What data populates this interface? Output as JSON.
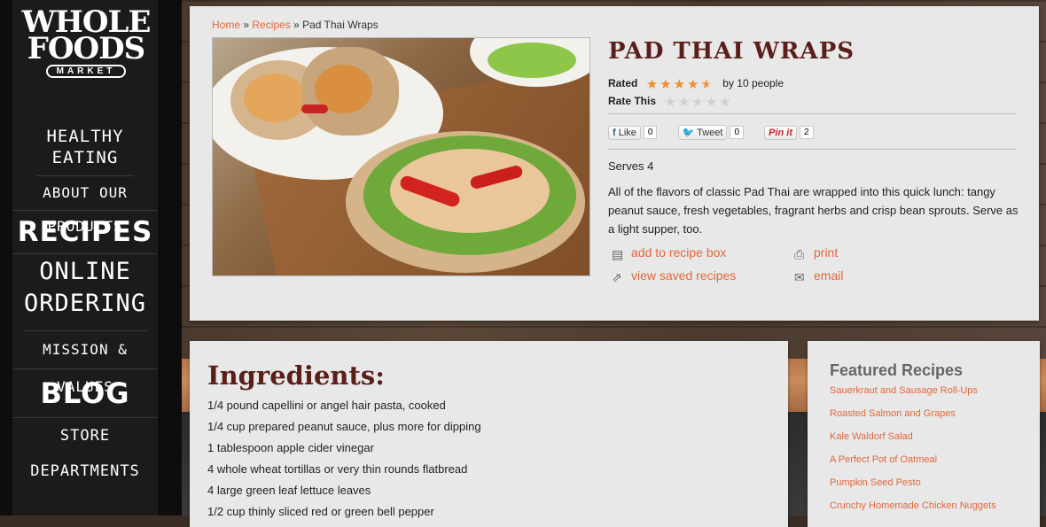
{
  "brand": {
    "line1": "WHOLE",
    "line2": "FOODS",
    "line3": "MARKET"
  },
  "nav": [
    {
      "label": "HEALTHY EATING"
    },
    {
      "label": "ABOUT OUR PRODUCTS"
    },
    {
      "label": "RECIPES"
    },
    {
      "label": "ONLINE ORDERING"
    },
    {
      "label": "MISSION & VALUES"
    },
    {
      "label": "BLOG"
    },
    {
      "label": "STORE DEPARTMENTS"
    }
  ],
  "breadcrumb": {
    "home": "Home",
    "sep1": " » ",
    "recipes": "Recipes",
    "sep2": " » ",
    "current": "Pad Thai Wraps"
  },
  "recipe": {
    "title": "PAD THAI WRAPS",
    "rated_label": "Rated",
    "rating": 4.5,
    "rated_by": "by 10 people",
    "rate_this_label": "Rate This",
    "serves": "Serves 4",
    "description": "All of the flavors of classic Pad Thai are wrapped into this quick lunch: tangy peanut sauce, fresh vegetables, fragrant herbs and crisp bean sprouts. Serve as a light supper, too."
  },
  "social": {
    "like_label": "Like",
    "like_count": "0",
    "tweet_label": "Tweet",
    "tweet_count": "0",
    "pin_label": "Pin it",
    "pin_count": "2"
  },
  "actions": {
    "add_box": "add to recipe box",
    "view_saved": "view saved recipes",
    "print": "print",
    "email": "email"
  },
  "ingredients": {
    "heading": "Ingredients:",
    "items": [
      "1/4 pound capellini or angel hair pasta, cooked",
      "1/4 cup prepared peanut sauce, plus more for dipping",
      "1 tablespoon apple cider vinegar",
      "4 whole wheat tortillas or very thin rounds flatbread",
      "4 large green leaf lettuce leaves",
      "1/2 cup thinly sliced red or green bell pepper"
    ]
  },
  "featured": {
    "heading": "Featured Recipes",
    "items": [
      "Sauerkraut and Sausage Roll-Ups",
      "Roasted Salmon and Grapes",
      "Kale Waldorf Salad",
      "A Perfect Pot of Oatmeal",
      "Pumpkin Seed Pesto",
      "Crunchy Homemade Chicken Nuggets"
    ]
  },
  "colors": {
    "accent": "#e2673a",
    "title": "#5a1f1a",
    "star": "#f0902a"
  }
}
